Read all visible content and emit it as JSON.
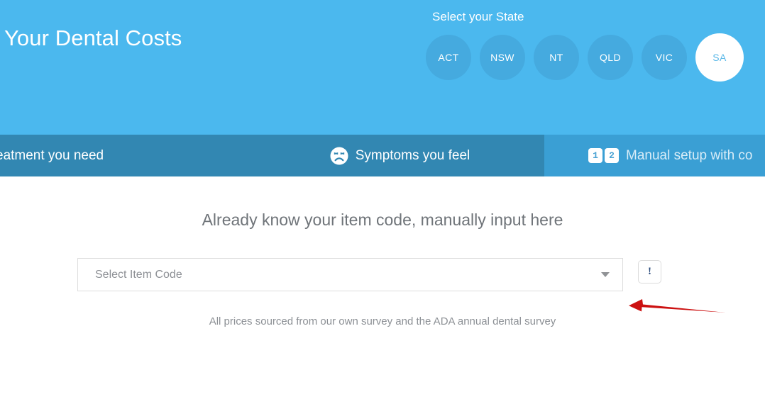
{
  "header": {
    "site_title": "Your Dental Costs",
    "background_color": "#4bb8ee",
    "state_selector": {
      "label": "Select your State",
      "selected": "SA",
      "options": [
        {
          "code": "ACT",
          "selected": false
        },
        {
          "code": "NSW",
          "selected": false
        },
        {
          "code": "NT",
          "selected": false
        },
        {
          "code": "QLD",
          "selected": false
        },
        {
          "code": "VIC",
          "selected": false
        },
        {
          "code": "SA",
          "selected": true
        }
      ],
      "selected_text_color": "#5cb9e8",
      "circle_color": "#45aadf"
    }
  },
  "tabs": {
    "background_color": "#3287b2",
    "active_background_color": "#3a9fd4",
    "items": [
      {
        "label": "eatment you need",
        "icon": "",
        "active": false
      },
      {
        "label": "Symptoms you feel",
        "icon": "sad-face-icon",
        "active": false
      },
      {
        "label": "Manual setup with co",
        "icon": "numbers-one-two-icon",
        "active": true,
        "digits": [
          "1",
          "2"
        ]
      }
    ]
  },
  "main": {
    "heading": "Already know your item code, manually input here",
    "select": {
      "placeholder": "Select Item Code",
      "value": "",
      "caret_icon": "chevron-down-icon"
    },
    "info_button": {
      "icon": "exclamation-icon",
      "glyph": "!",
      "color": "#28497a"
    },
    "source_note": "All prices sourced from our own survey and the ADA annual dental survey"
  },
  "annotation": {
    "arrow_color": "#cc1111",
    "direction": "left"
  }
}
